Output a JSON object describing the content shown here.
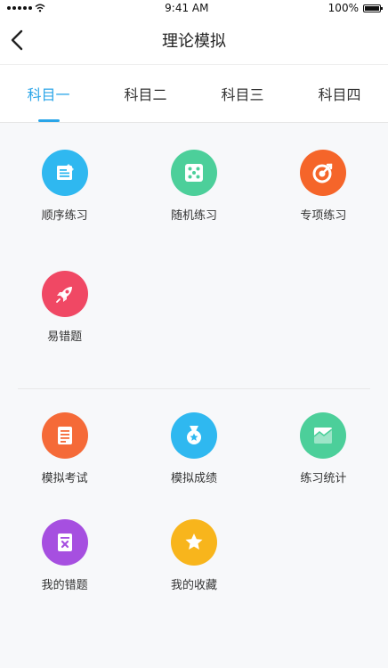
{
  "status": {
    "time": "9:41 AM",
    "battery": "100%"
  },
  "nav": {
    "title": "理论模拟"
  },
  "tabs": [
    {
      "label": "科目一",
      "active": true
    },
    {
      "label": "科目二",
      "active": false
    },
    {
      "label": "科目三",
      "active": false
    },
    {
      "label": "科目四",
      "active": false
    }
  ],
  "practice": [
    {
      "label": "顺序练习",
      "icon": "notepad-icon",
      "color": "#2fb8f0"
    },
    {
      "label": "随机练习",
      "icon": "dice-icon",
      "color": "#4ccf9a"
    },
    {
      "label": "专项练习",
      "icon": "target-icon",
      "color": "#f5652a"
    },
    {
      "label": "易错题",
      "icon": "rocket-icon",
      "color": "#f04864"
    }
  ],
  "exam": [
    {
      "label": "模拟考试",
      "icon": "document-icon",
      "color": "#f56a38"
    },
    {
      "label": "模拟成绩",
      "icon": "medal-icon",
      "color": "#2fb8f0"
    },
    {
      "label": "练习统计",
      "icon": "chart-icon",
      "color": "#4ccf9a"
    },
    {
      "label": "我的错题",
      "icon": "wrong-icon",
      "color": "#a64fe0"
    },
    {
      "label": "我的收藏",
      "icon": "star-icon",
      "color": "#f8b51c"
    }
  ]
}
